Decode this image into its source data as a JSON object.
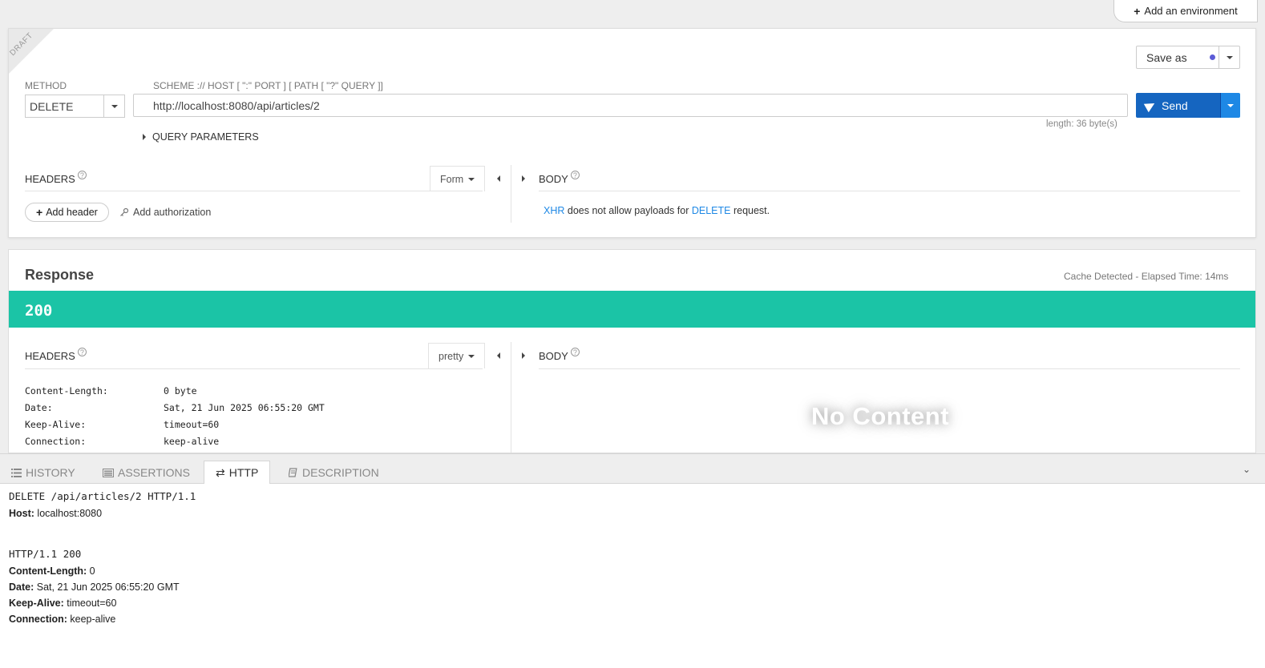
{
  "env": {
    "add_label": "Add an environment"
  },
  "request": {
    "draft_label": "DRAFT",
    "method_label": "METHOD",
    "method_value": "DELETE",
    "url_label": "SCHEME :// HOST [ \":\" PORT ] [ PATH [ \"?\" QUERY ]]",
    "url_value": "http://localhost:8080/api/articles/2",
    "length_text": "length: 36 byte(s)",
    "save_label": "Save as",
    "send_label": "Send",
    "query_params_label": "QUERY PARAMETERS",
    "headers_label": "HEADERS",
    "form_label": "Form",
    "body_label": "BODY",
    "add_header_label": "Add header",
    "add_auth_label": "Add authorization",
    "xhr_msg": {
      "xhr": "XHR",
      "mid": " does not allow payloads for ",
      "method": "DELETE",
      "end": " request."
    }
  },
  "response": {
    "title": "Response",
    "meta": "Cache Detected - Elapsed Time: 14ms",
    "status": "200",
    "status_color": "#1bc4a6",
    "headers_label": "HEADERS",
    "pretty_label": "pretty",
    "body_label": "BODY",
    "headers": [
      {
        "k": "Content-Length:",
        "v": "0 byte"
      },
      {
        "k": "Date:",
        "v": "Sat, 21 Jun 2025 06:55:20 GMT"
      },
      {
        "k": "Keep-Alive:",
        "v": "timeout=60"
      },
      {
        "k": "Connection:",
        "v": "keep-alive"
      }
    ],
    "no_content": "No Content"
  },
  "tabs": [
    {
      "label": "HISTORY",
      "icon": "list-icon"
    },
    {
      "label": "ASSERTIONS",
      "icon": "assertions-icon"
    },
    {
      "label": "HTTP",
      "icon": "exchange-icon",
      "active": true
    },
    {
      "label": "DESCRIPTION",
      "icon": "book-icon"
    }
  ],
  "http": {
    "request_line": "DELETE /api/articles/2 HTTP/1.1",
    "request_headers": [
      {
        "k": "Host:",
        "v": " localhost:8080"
      }
    ],
    "response_line": "HTTP/1.1 200",
    "response_headers": [
      {
        "k": "Content-Length:",
        "v": " 0"
      },
      {
        "k": "Date:",
        "v": " Sat, 21 Jun 2025 06:55:20 GMT"
      },
      {
        "k": "Keep-Alive:",
        "v": " timeout=60"
      },
      {
        "k": "Connection:",
        "v": " keep-alive"
      }
    ]
  }
}
